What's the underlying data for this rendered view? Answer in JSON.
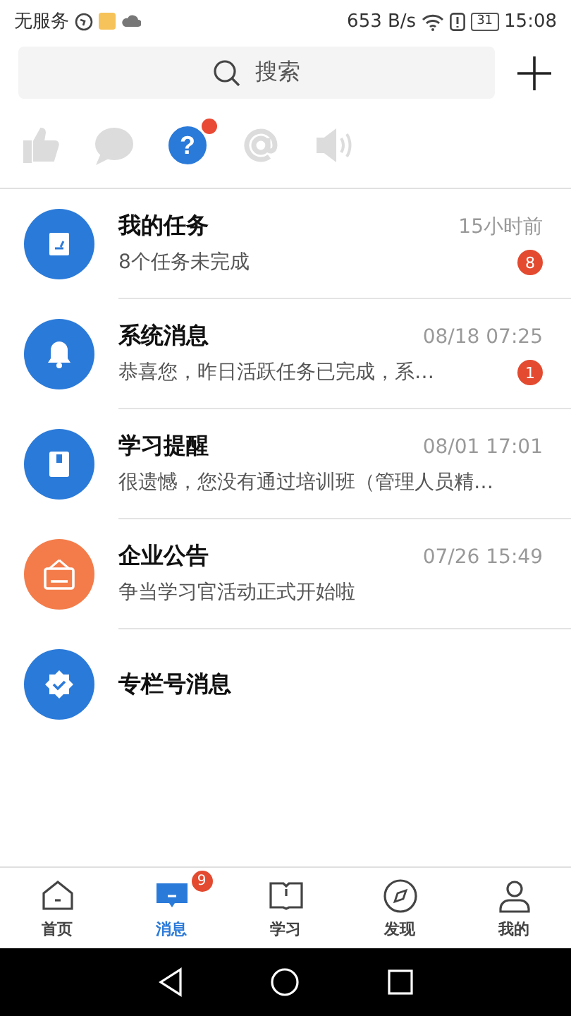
{
  "status_bar": {
    "carrier": "无服务",
    "speed": "653 B/s",
    "battery": "31",
    "time": "15:08"
  },
  "search": {
    "placeholder": "搜索"
  },
  "filters": [
    {
      "kind": "like",
      "selected": false,
      "dot": false
    },
    {
      "kind": "comment",
      "selected": false,
      "dot": false
    },
    {
      "kind": "question",
      "glyph": "?",
      "selected": true,
      "dot": true
    },
    {
      "kind": "at",
      "selected": false,
      "dot": false
    },
    {
      "kind": "speaker",
      "selected": false,
      "dot": false
    }
  ],
  "messages": [
    {
      "kind": "task",
      "color": "#2a7ad9",
      "title": "我的任务",
      "time": "15小时前",
      "preview": "8个任务未完成",
      "badge": "8"
    },
    {
      "kind": "bell",
      "color": "#2a7ad9",
      "title": "系统消息",
      "time": "08/18 07:25",
      "preview": "恭喜您，昨日活跃任务已完成，系…",
      "badge": "1"
    },
    {
      "kind": "book",
      "color": "#2a7ad9",
      "title": "学习提醒",
      "time": "08/01 17:01",
      "preview": "很遗憾，您没有通过培训班（管理人员精…"
    },
    {
      "kind": "notice",
      "color": "#f47c4a",
      "title": "企业公告",
      "time": "07/26 15:49",
      "preview": "争当学习官活动正式开始啦"
    },
    {
      "kind": "badge",
      "color": "#2a7ad9",
      "title": "专栏号消息"
    }
  ],
  "tabs": [
    {
      "kind": "home",
      "label": "首页",
      "selected": false
    },
    {
      "kind": "message",
      "label": "消息",
      "selected": true,
      "badge": "9"
    },
    {
      "kind": "study",
      "label": "学习",
      "selected": false
    },
    {
      "kind": "discover",
      "label": "发现",
      "selected": false
    },
    {
      "kind": "me",
      "label": "我的",
      "selected": false
    }
  ]
}
